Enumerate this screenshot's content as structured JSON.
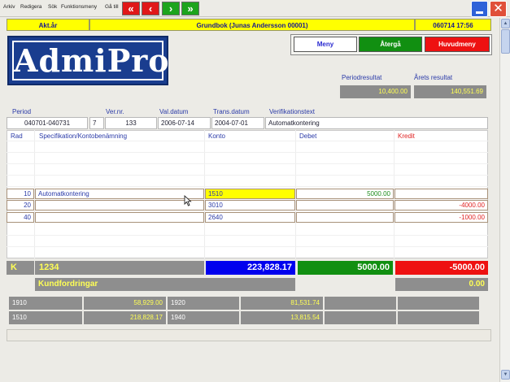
{
  "menubar": {
    "items": [
      "Arkiv",
      "Redigera",
      "Sök",
      "Funktionsmeny",
      "Gå till"
    ]
  },
  "nav": {
    "first_icon": "double-left-arrow-icon",
    "prev_icon": "left-arrow-icon",
    "next_icon": "right-arrow-icon",
    "last_icon": "double-right-arrow-icon",
    "first_glyph": "«",
    "prev_glyph": "‹",
    "next_glyph": "›",
    "last_glyph": "»"
  },
  "window": {
    "minimize_icon": "minimize-icon",
    "close_icon": "close-icon",
    "close_glyph": "✕"
  },
  "header": {
    "left": "Akt.år",
    "center": "Grundbok (Junas Andersson 00001)",
    "right": "060714 17:56"
  },
  "logo": {
    "text": "AdmiPro"
  },
  "buttons": {
    "meny": "Meny",
    "atergå": "Återgå",
    "huvudmeny": "Huvudmeny"
  },
  "results": {
    "period_label": "Periodresultat",
    "period_value": "10,400.00",
    "year_label": "Årets resultat",
    "year_value": "140,551.69"
  },
  "form": {
    "labels": {
      "period": "Period",
      "vernr": "Ver.nr.",
      "valdatum": "Val.datum",
      "transdatum": "Trans.datum",
      "vertext": "Verifikationstext"
    },
    "values": {
      "period": "040701-040731",
      "series": "7",
      "vernr": "133",
      "valdatum": "2006-07-14",
      "transdatum": "2004-07-01",
      "vertext": "Automatkontering"
    }
  },
  "table": {
    "headers": {
      "rad": "Rad",
      "spec": "Specifikation/Kontobenämning",
      "konto": "Konto",
      "debet": "Debet",
      "kredit": "Kredit"
    },
    "rows": [
      {
        "rad": "10",
        "spec": "Automatkontering",
        "konto": "1510",
        "debet": "5000.00",
        "kredit": ""
      },
      {
        "rad": "20",
        "spec": "",
        "konto": "3010",
        "debet": "",
        "kredit": "-4000.00"
      },
      {
        "rad": "40",
        "spec": "",
        "konto": "2640",
        "debet": "",
        "kredit": "-1000.00"
      }
    ]
  },
  "totals": {
    "k_label": "K",
    "account": "1234",
    "account_name": "Kundfordringar",
    "balance": "223,828.17",
    "debet": "5000.00",
    "kredit": "-5000.00",
    "diff": "0.00"
  },
  "accounts": [
    {
      "num": "1910",
      "value": "58,929.00"
    },
    {
      "num": "1920",
      "value": "81,531.74"
    },
    {
      "num": "1510",
      "value": "218,828.17"
    },
    {
      "num": "1940",
      "value": "13,815.54"
    }
  ],
  "colors": {
    "accent_yellow": "#ffff00",
    "accent_red": "#ee1111",
    "accent_green": "#118f11",
    "accent_blue": "#0000ee"
  }
}
